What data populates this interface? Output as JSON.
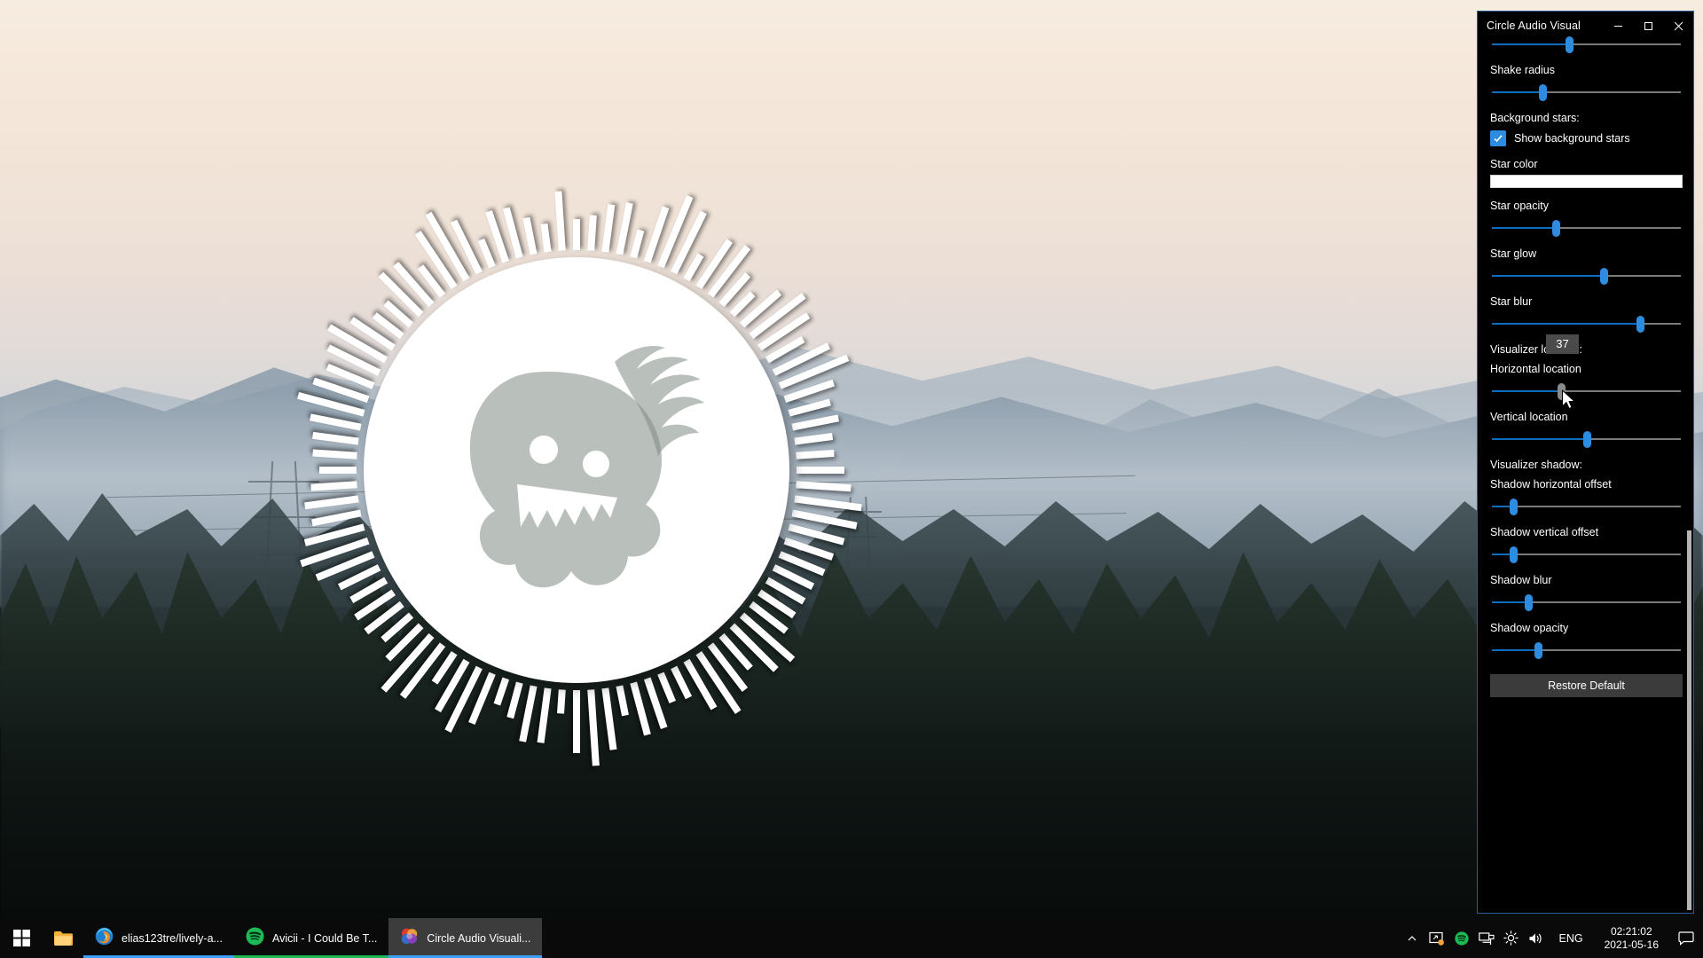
{
  "window": {
    "title": "Circle Audio Visual",
    "minimize_label": "—",
    "maximize_label": "□",
    "close_label": "✕"
  },
  "settings": {
    "top_slider": {
      "name": "partial-slider",
      "value_pct": 41
    },
    "shake_radius": {
      "label": "Shake radius",
      "value_pct": 27
    },
    "background_stars_group": {
      "label": "Background stars:"
    },
    "show_background_stars": {
      "label": "Show background stars",
      "checked": true
    },
    "star_color": {
      "label": "Star color",
      "color": "#ffffff"
    },
    "star_opacity": {
      "label": "Star opacity",
      "value_pct": 34
    },
    "star_glow": {
      "label": "Star glow",
      "value_pct": 59
    },
    "star_blur": {
      "label": "Star blur",
      "value_pct": 78
    },
    "visualizer_location_group": {
      "label": "Visualizer location:"
    },
    "horizontal_location": {
      "label": "Horizontal location",
      "value_pct": 37,
      "tooltip": "37",
      "dragging": true
    },
    "vertical_location": {
      "label": "Vertical location",
      "value_pct": 50
    },
    "visualizer_shadow_group": {
      "label": "Visualizer shadow:"
    },
    "shadow_horizontal_offset": {
      "label": "Shadow horizontal offset",
      "value_pct": 12
    },
    "shadow_vertical_offset": {
      "label": "Shadow vertical offset",
      "value_pct": 12
    },
    "shadow_blur": {
      "label": "Shadow blur",
      "value_pct": 20
    },
    "shadow_opacity": {
      "label": "Shadow opacity",
      "value_pct": 25
    },
    "restore_default": {
      "label": "Restore Default"
    }
  },
  "taskbar": {
    "start": "start-icon",
    "file_explorer": "folder-icon",
    "items": [
      {
        "icon": "firefox-icon",
        "label": "elias123tre/lively-a...",
        "active": false,
        "accent": "#3aa0ff"
      },
      {
        "icon": "spotify-icon",
        "label": "Avicii - I Could Be T...",
        "active": false,
        "accent": "#1db954"
      },
      {
        "icon": "circle-audio-visual-icon",
        "label": "Circle Audio Visuali...",
        "active": true,
        "accent": "#3aa0ff"
      }
    ],
    "tray": {
      "chevron": "chevron-up-icon",
      "icons": [
        "screen-share-icon",
        "spotify-tray-icon",
        "network-icon",
        "brightness-icon",
        "volume-icon"
      ],
      "language": "ENG",
      "time": "02:21:02",
      "date": "2021-05-16",
      "notifications": "notification-icon"
    }
  },
  "colors": {
    "accent_blue": "#2d8ce0",
    "track_fill": "#0d6ebf",
    "track": "#7a7a7a",
    "window_bg": "#000000",
    "tooltip_bg": "#4a4a4a",
    "taskbar_bg": "#0a0a0a"
  }
}
